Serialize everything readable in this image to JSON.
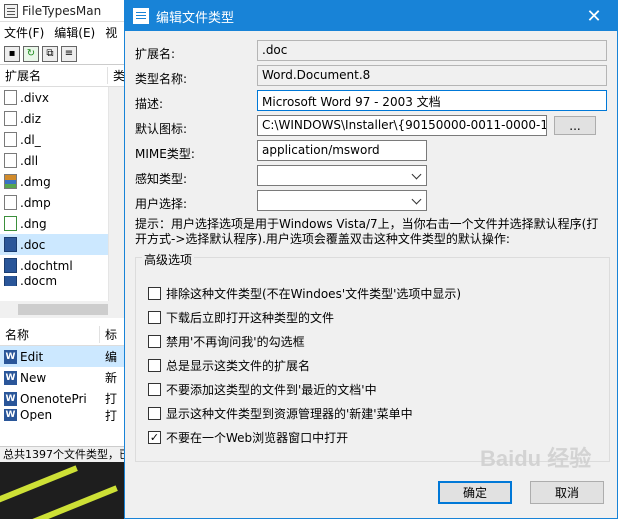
{
  "main": {
    "title": "FileTypesMan",
    "menu": [
      "文件(F)",
      "编辑(E)",
      "视"
    ],
    "columns": {
      "ext": "扩展名",
      "type": "类"
    },
    "rows": [
      {
        "ext": ".divx",
        "type": "",
        "icon": "file-icon"
      },
      {
        "ext": ".diz",
        "type": "",
        "icon": "file-icon"
      },
      {
        "ext": ".dl_",
        "type": "",
        "icon": "file-icon"
      },
      {
        "ext": ".dll",
        "type": "d",
        "icon": "file-icon"
      },
      {
        "ext": ".dmg",
        "type": "",
        "icon": "archive-icon"
      },
      {
        "ext": ".dmp",
        "type": "V",
        "icon": "file-icon"
      },
      {
        "ext": ".dng",
        "type": "P",
        "icon": "image-icon"
      },
      {
        "ext": ".doc",
        "type": "W",
        "icon": "word-icon"
      },
      {
        "ext": ".dochtml",
        "type": "",
        "icon": "word-icon"
      },
      {
        "ext": ".docm",
        "type": "W",
        "icon": "word-icon"
      }
    ],
    "lower_columns": {
      "name": "名称",
      "title": "标"
    },
    "actions": [
      {
        "name": "Edit",
        "title": "编"
      },
      {
        "name": "New",
        "title": "新"
      },
      {
        "name": "OnenotePri",
        "title": "打"
      },
      {
        "name": "Open",
        "title": "打"
      }
    ],
    "status": "总共1397个文件类型，已"
  },
  "dialog": {
    "title": "编辑文件类型",
    "labels": {
      "ext": "扩展名:",
      "typename": "类型名称:",
      "desc": "描述:",
      "icon": "默认图标:",
      "mime": "MIME类型:",
      "perceived": "感知类型:",
      "user_choice": "用户选择:"
    },
    "values": {
      "ext": ".doc",
      "typename": "Word.Document.8",
      "desc": "Microsoft Word 97 - 2003 文档",
      "icon": "C:\\WINDOWS\\Installer\\{90150000-0011-0000-1000-0000C",
      "mime": "application/msword",
      "perceived": "",
      "user_choice": ""
    },
    "browse_label": "...",
    "hint": "提示：用户选择选项是用于Windows Vista/7上，当你右击一个文件并选择默认程序(打开方式->选择默认程序).用户选项会覆盖双击这种文件类型的默认操作:",
    "advanced_label": "高级选项",
    "options": [
      {
        "label": "排除这种文件类型(不在Windoes'文件类型'选项中显示)",
        "checked": false
      },
      {
        "label": "下载后立即打开这种类型的文件",
        "checked": false
      },
      {
        "label": "禁用'不再询问我'的勾选框",
        "checked": false
      },
      {
        "label": "总是显示这类文件的扩展名",
        "checked": false
      },
      {
        "label": "不要添加这类型的文件到'最近的文档'中",
        "checked": false
      },
      {
        "label": "显示这种文件类型到资源管理器的'新建'菜单中",
        "checked": false
      },
      {
        "label": "不要在一个Web浏览器窗口中打开",
        "checked": true
      }
    ],
    "ok_label": "确定",
    "cancel_label": "取消",
    "watermark": "Baidu 经验"
  },
  "colors": {
    "accent": "#1883d7",
    "selection": "#cce8ff",
    "dialog_bg": "#f0f0f0"
  }
}
